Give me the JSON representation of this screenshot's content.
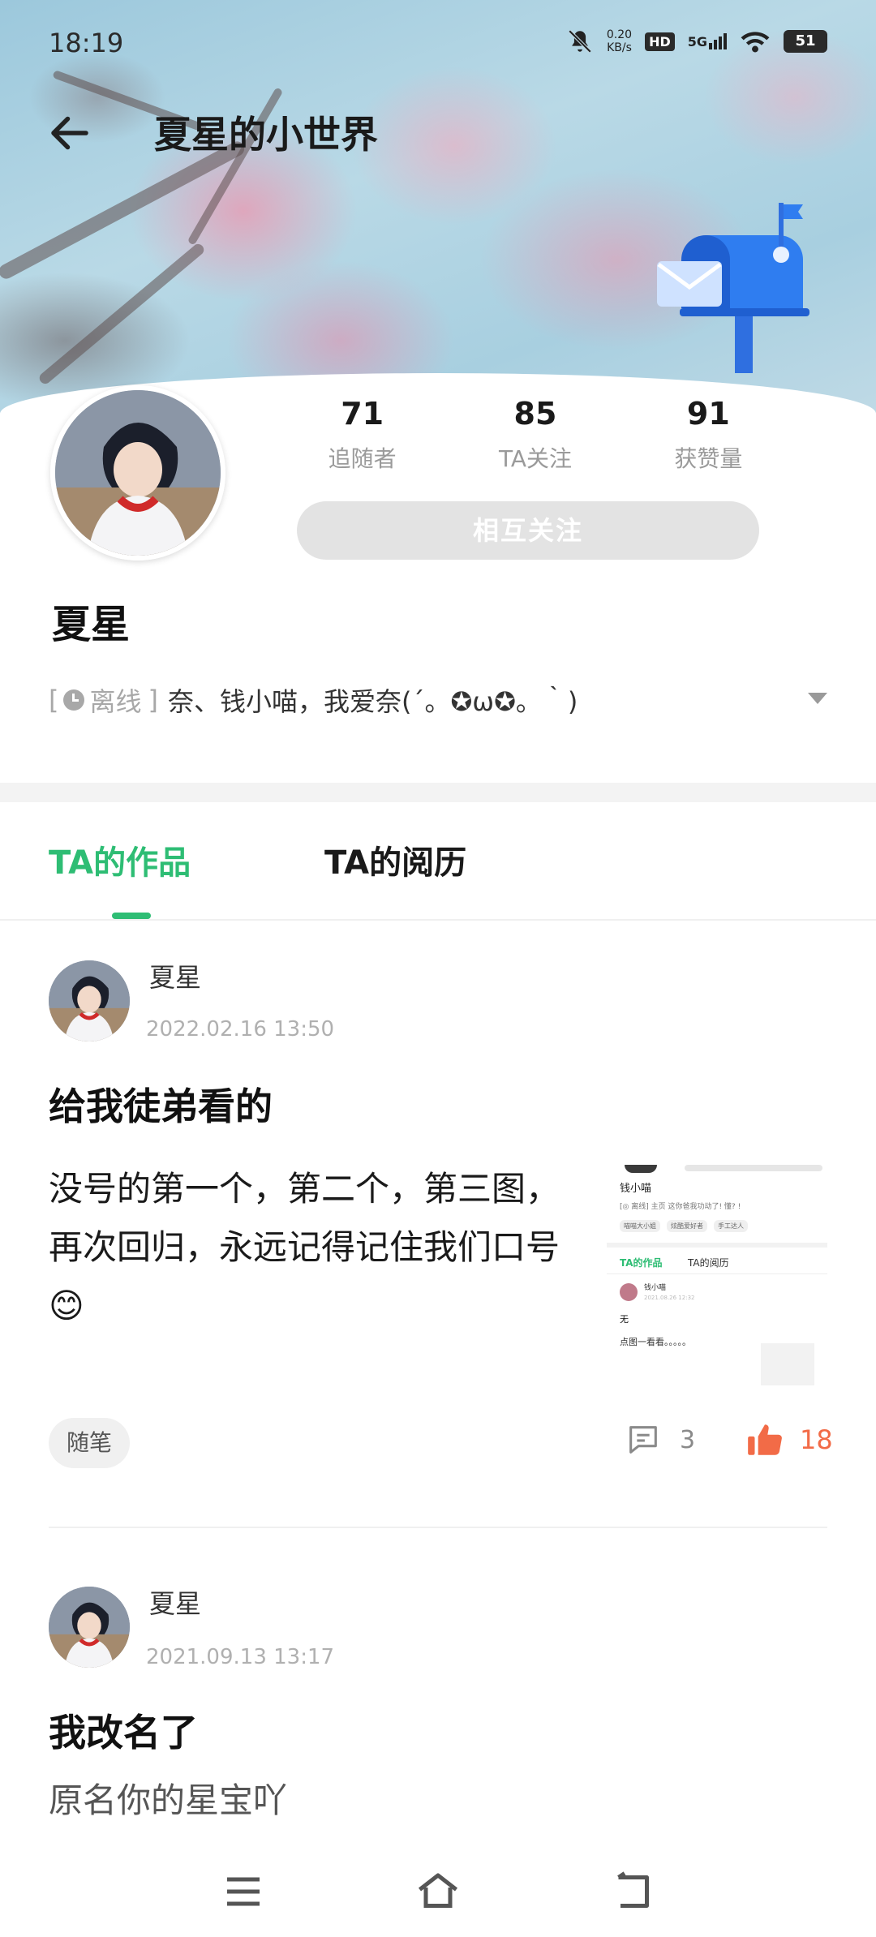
{
  "status_bar": {
    "time": "18:19",
    "net_speed_value": "0.20",
    "net_speed_unit": "KB/s",
    "hd": "HD",
    "signal": "5G",
    "battery": "51"
  },
  "header": {
    "title": "夏星的小世界"
  },
  "profile": {
    "stats": [
      {
        "value": "71",
        "label": "追随者"
      },
      {
        "value": "85",
        "label": "TA关注"
      },
      {
        "value": "91",
        "label": "获赞量"
      }
    ],
    "mutual_button": "相互关注",
    "name": "夏星",
    "status_open": "[",
    "status_offline": "离线",
    "status_close": "]",
    "signature": "奈、钱小喵，我爱奈(´。✪ω✪。｀)"
  },
  "tabs": [
    {
      "label": "TA的作品",
      "active": true
    },
    {
      "label": "TA的阅历",
      "active": false
    }
  ],
  "posts": [
    {
      "author": "夏星",
      "date": "2022.02.16 13:50",
      "title": "给我徒弟看的",
      "body": "没号的第一个，第二个，第三图，再次回归，永远记得记住我们口号😊",
      "tag": "随笔",
      "comments": "3",
      "likes": "18",
      "thumbnail": {
        "name": "钱小喵",
        "desc": "[◎ 离线] 主页 这你爸我功动了! 懂? !",
        "chips": [
          "喵喵大小姐",
          "炫酷爱好者",
          "手工达人"
        ],
        "tab_active": "TA的作品",
        "tab_inactive": "TA的阅历",
        "post_author": "钱小喵",
        "post_date": "2021.08.26 12:32",
        "post_title": "无",
        "post_body": "点图一看看。。。。。"
      }
    },
    {
      "author": "夏星",
      "date": "2021.09.13 13:17",
      "title": "我改名了",
      "body": "原名你的星宝吖"
    }
  ],
  "colors": {
    "accent_green": "#2ebd74",
    "like_orange": "#f26b47",
    "button_gray": "#e3e3e3"
  }
}
